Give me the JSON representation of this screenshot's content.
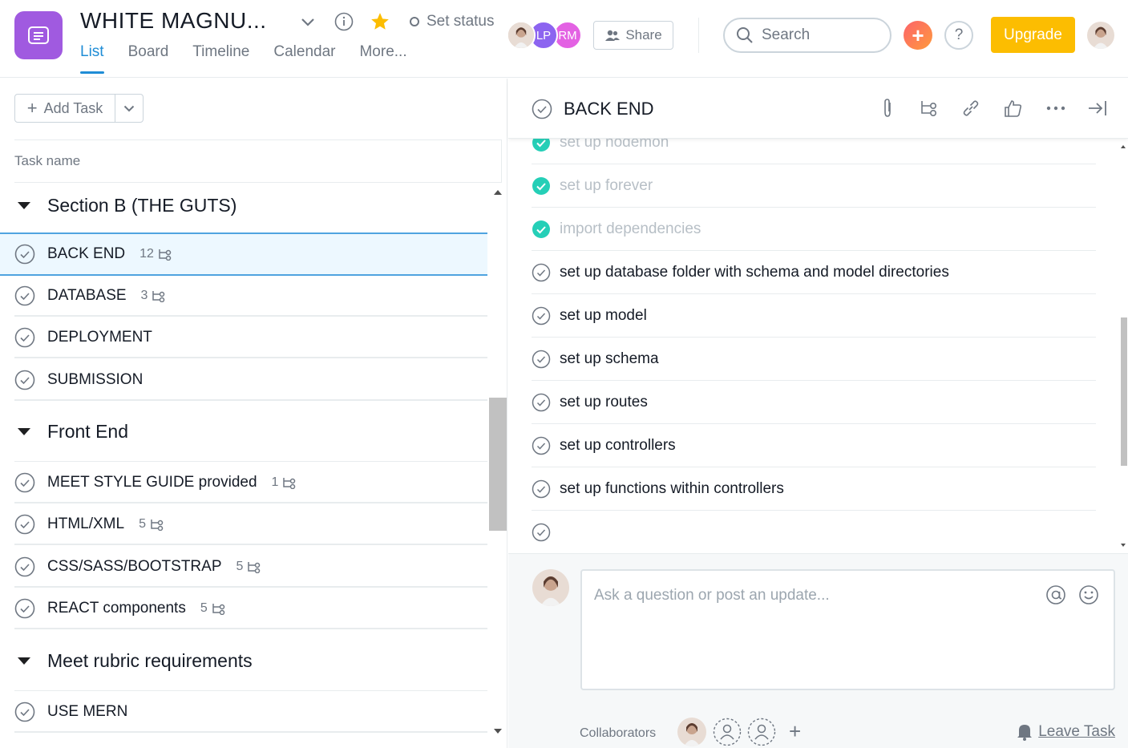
{
  "header": {
    "project_title": "WHITE MAGNU...",
    "set_status": "Set status",
    "tabs": [
      {
        "label": "List"
      },
      {
        "label": "Board"
      },
      {
        "label": "Timeline"
      },
      {
        "label": "Calendar"
      },
      {
        "label": "More..."
      }
    ],
    "members": [
      {
        "initials": "",
        "color": "#c9a48e"
      },
      {
        "initials": "LP",
        "color": "#8c64f0"
      },
      {
        "initials": "RM",
        "color": "#e362e3"
      }
    ],
    "share_label": "Share",
    "search_placeholder": "Search",
    "help_label": "?",
    "upgrade_label": "Upgrade",
    "colors": {
      "accent": "#1f8dd6",
      "upgrade": "#fcbd01",
      "project": "#a05ae0"
    }
  },
  "left": {
    "add_task_label": "Add Task",
    "column_header": "Task name",
    "sections": [
      {
        "title": "Section B (THE GUTS)",
        "tasks": [
          {
            "name": "BACK END",
            "count": "12",
            "selected": true
          },
          {
            "name": "DATABASE",
            "count": "3"
          },
          {
            "name": "DEPLOYMENT",
            "count": ""
          },
          {
            "name": "SUBMISSION",
            "count": ""
          }
        ]
      },
      {
        "title": "Front End",
        "tasks": [
          {
            "name": "MEET STYLE GUIDE provided",
            "count": "1"
          },
          {
            "name": "HTML/XML",
            "count": "5"
          },
          {
            "name": "CSS/SASS/BOOTSTRAP",
            "count": "5"
          },
          {
            "name": "REACT components",
            "count": "5"
          }
        ]
      },
      {
        "title": "Meet rubric requirements",
        "tasks": [
          {
            "name": "USE MERN",
            "count": ""
          }
        ]
      }
    ]
  },
  "detail": {
    "title": "BACK END",
    "subtasks": [
      {
        "name": "set up nodemon",
        "done": true
      },
      {
        "name": "set up forever",
        "done": true
      },
      {
        "name": "import dependencies",
        "done": true
      },
      {
        "name": "set up database folder with schema and model directories",
        "done": false
      },
      {
        "name": "set up model",
        "done": false
      },
      {
        "name": "set up schema",
        "done": false
      },
      {
        "name": "set up routes",
        "done": false
      },
      {
        "name": "set up controllers",
        "done": false
      },
      {
        "name": "set up functions within controllers",
        "done": false
      },
      {
        "name": "",
        "done": false
      }
    ],
    "comment_placeholder": "Ask a question or post an update...",
    "collaborators_label": "Collaborators",
    "leave_label": "Leave Task"
  }
}
